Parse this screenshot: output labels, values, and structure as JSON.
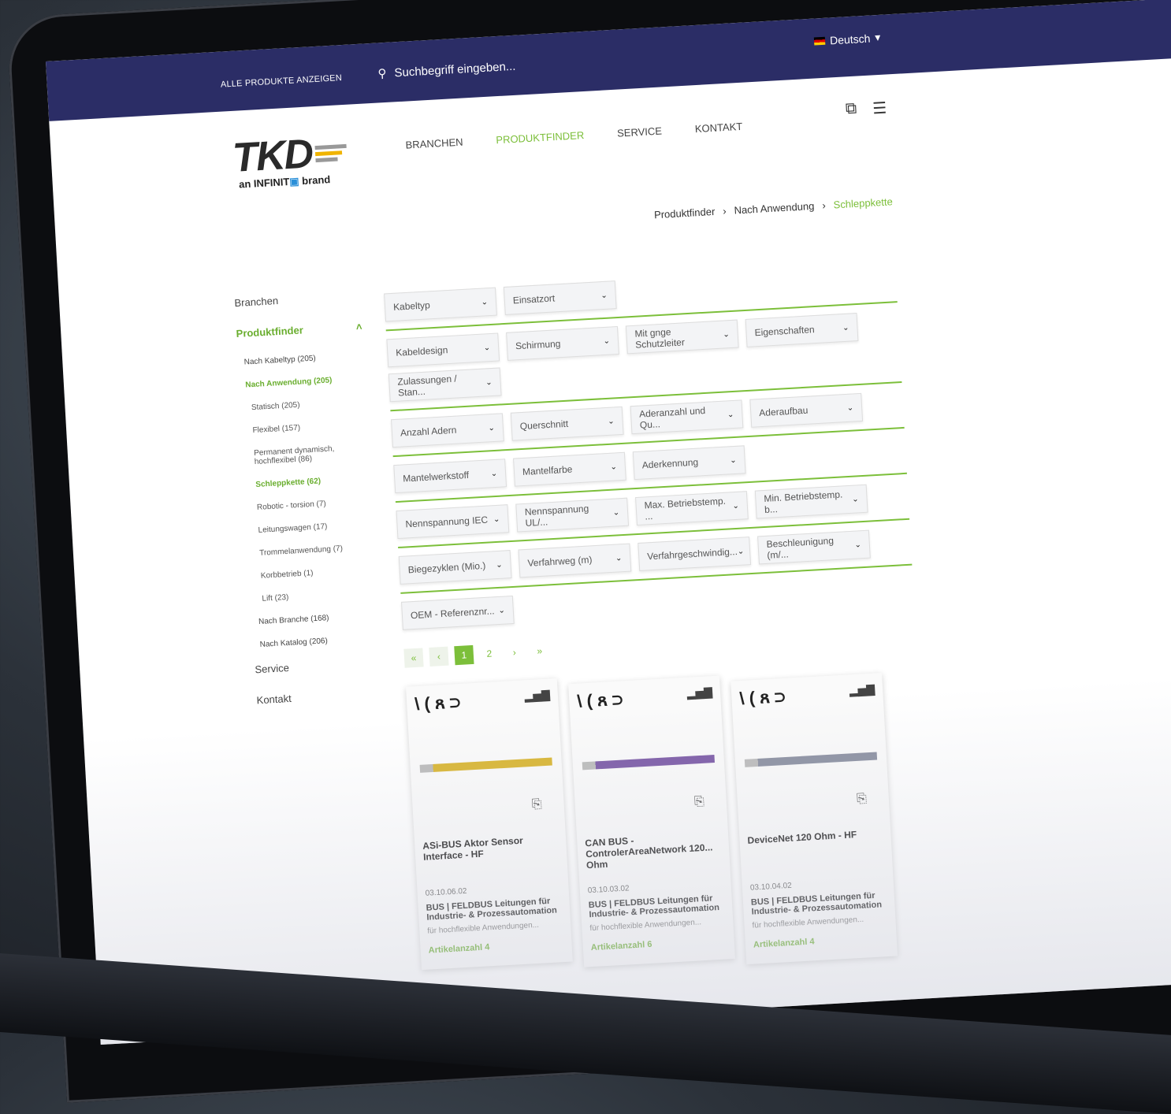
{
  "topbar": {
    "all_products": "ALLE PRODUKTE ANZEIGEN",
    "search_placeholder": "Suchbegriff eingeben...",
    "language": "Deutsch"
  },
  "logo": {
    "main": "TKD",
    "sub_prefix": "an INFINIT",
    "sub_suffix": " brand"
  },
  "nav": [
    "BRANCHEN",
    "PRODUKTFINDER",
    "SERVICE",
    "KONTAKT"
  ],
  "breadcrumb": [
    "Produktfinder",
    "Nach Anwendung",
    "Schleppkette"
  ],
  "sidebar": {
    "branchen": "Branchen",
    "produktfinder": "Produktfinder",
    "sub": [
      "Nach Kabeltyp (205)",
      "Nach Anwendung (205)"
    ],
    "anwendungen": [
      "Statisch (205)",
      "Flexibel (157)",
      "Permanent dynamisch, hochflexibel (86)",
      "Schleppkette (62)",
      "Robotic - torsion (7)",
      "Leitungswagen (17)",
      "Trommelanwendung (7)",
      "Korbbetrieb (1)",
      "Lift (23)"
    ],
    "more": [
      "Nach Branche (168)",
      "Nach Katalog (206)"
    ],
    "service": "Service",
    "kontakt": "Kontakt"
  },
  "filters": [
    [
      "Kabeltyp",
      "Einsatzort"
    ],
    [
      "Kabeldesign",
      "Schirmung",
      "Mit gnge Schutzleiter",
      "Eigenschaften",
      "Zulassungen / Stan..."
    ],
    [
      "Anzahl Adern",
      "Querschnitt",
      "Aderanzahl und Qu...",
      "Aderaufbau"
    ],
    [
      "Mantelwerkstoff",
      "Mantelfarbe",
      "Aderkennung"
    ],
    [
      "Nennspannung IEC",
      "Nennspannung UL/...",
      "Max. Betriebstemp. ...",
      "Min. Betriebstemp. b..."
    ],
    [
      "Biegezyklen (Mio.)",
      "Verfahrweg (m)",
      "Verfahrgeschwindig...",
      "Beschleunigung (m/..."
    ],
    [
      "OEM - Referenznr..."
    ]
  ],
  "pager": [
    "«",
    "‹",
    "1",
    "2",
    "›",
    "»"
  ],
  "products": [
    {
      "title": "ASi-BUS Aktor Sensor Interface - HF",
      "code": "03.10.06.02",
      "category": "BUS | FELDBUS Leitungen für Industrie- & Prozessautomation",
      "desc": "für hochflexible Anwendungen...",
      "count": "Artikelanzahl 4",
      "cable_color": "#d9b532"
    },
    {
      "title": "CAN BUS - ControlerAreaNetwork 120... Ohm",
      "code": "03.10.03.02",
      "category": "BUS | FELDBUS Leitungen für Industrie- & Prozessautomation",
      "desc": "für hochflexible Anwendungen...",
      "count": "Artikelanzahl 6",
      "cable_color": "#7b5aa6"
    },
    {
      "title": "DeviceNet 120 Ohm - HF",
      "code": "03.10.04.02",
      "category": "BUS | FELDBUS Leitungen für Industrie- & Prozessautomation",
      "desc": "für hochflexible Anwendungen...",
      "count": "Artikelanzahl 4",
      "cable_color": "#8a8fa0"
    }
  ],
  "product_symbols": "\\ ( ጸ ⊃"
}
